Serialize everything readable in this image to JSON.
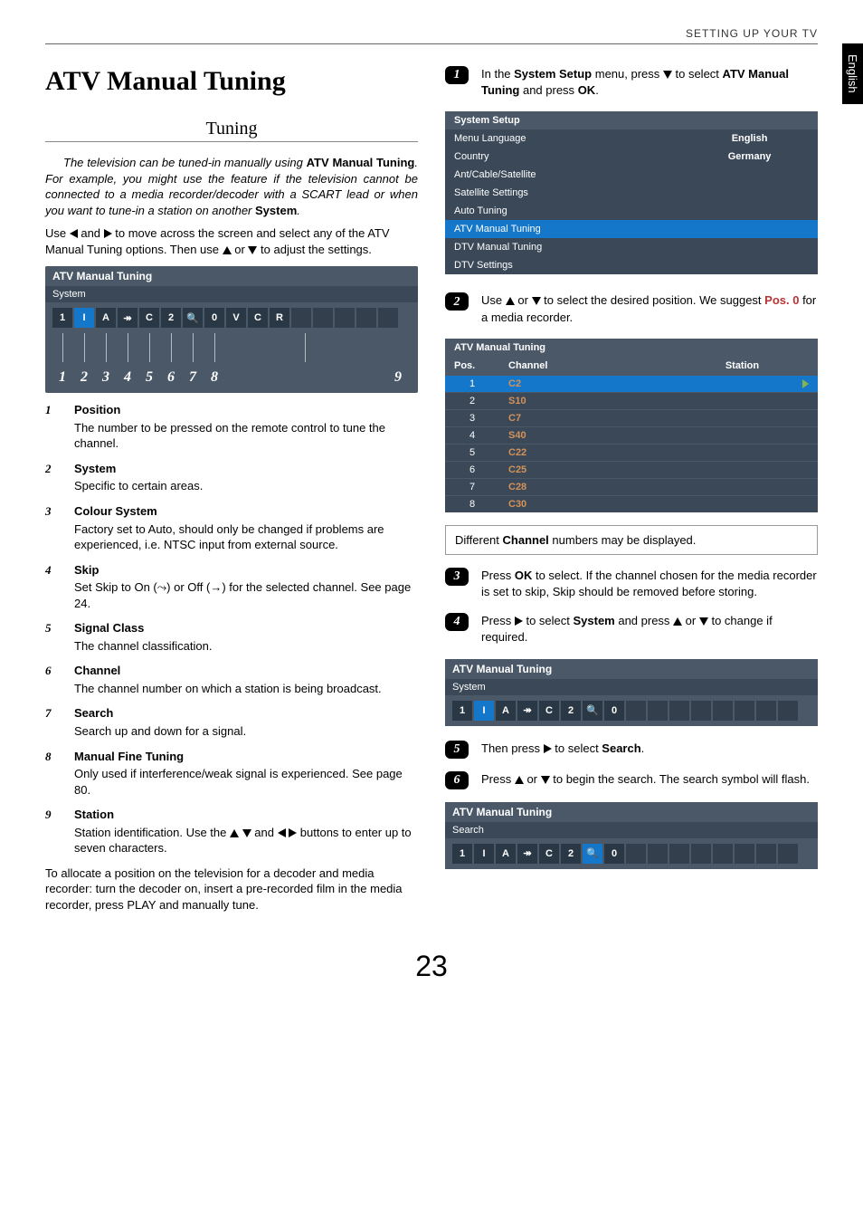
{
  "header": {
    "section": "SETTING UP YOUR TV",
    "lang_tab": "English"
  },
  "title": "ATV Manual Tuning",
  "subheading": "Tuning",
  "intro": {
    "pre": "The television can be tuned-in manually using ",
    "bold1": "ATV Manual Tuning",
    "mid": ". For example, you might use the feature if the television cannot be connected to a media recorder/decoder with a SCART lead or when you want to tune-in a station on another ",
    "bold2": "System",
    "post": "."
  },
  "use_arrows": {
    "p1a": "Use ",
    "p1b": " and ",
    "p1c": " to move across the screen and select any of the ATV Manual Tuning options. Then use ",
    "p1d": " or ",
    "p1e": " to adjust the settings."
  },
  "diagram": {
    "title": "ATV Manual Tuning",
    "sub": "System",
    "cells": [
      "1",
      "I",
      "A",
      "↠",
      "C",
      "2",
      "🔍",
      "0",
      "V",
      "C",
      "R",
      "",
      "",
      "",
      "",
      ""
    ],
    "numbers": [
      "1",
      "2",
      "3",
      "4",
      "5",
      "6",
      "7",
      "8"
    ],
    "last_number": "9"
  },
  "defs": [
    {
      "n": "1",
      "title": "Position",
      "body": "The number to be pressed on the remote control to tune the channel."
    },
    {
      "n": "2",
      "title": "System",
      "body": "Specific to certain areas."
    },
    {
      "n": "3",
      "title": "Colour System",
      "body": "Factory set to Auto, should only be changed if problems are experienced, i.e. NTSC input from external source."
    },
    {
      "n": "4",
      "title": "Skip",
      "body_pre": "Set Skip to On (",
      "icon_on": "⤳",
      "body_mid": ") or Off (",
      "icon_off": "→",
      "body_post": ") for the selected channel. See page 24."
    },
    {
      "n": "5",
      "title": "Signal Class",
      "body": "The channel classification."
    },
    {
      "n": "6",
      "title": "Channel",
      "body": "The channel number on which a station is being broadcast."
    },
    {
      "n": "7",
      "title": "Search",
      "body": "Search up and down for a signal."
    },
    {
      "n": "8",
      "title": "Manual Fine Tuning",
      "body": "Only used if interference/weak signal is experienced. See page 80."
    },
    {
      "n": "9",
      "title": "Station",
      "body_pre": "Station identification. Use the ",
      "body_post": " buttons to enter up to seven characters."
    }
  ],
  "allocate": "To allocate a position on the television for a decoder and media recorder: turn the decoder on, insert a pre-recorded film in the media recorder, press PLAY and manually tune.",
  "steps": {
    "s1": {
      "pre": "In the ",
      "b1": "System Setup",
      "mid": " menu, press ",
      "mid2": " to select ",
      "b2": "ATV Manual Tuning",
      "mid3": " and press ",
      "b3": "OK",
      "post": "."
    },
    "s2": {
      "pre": "Use ",
      "mid": " or ",
      "mid2": " to select the desired position. We suggest ",
      "pos": "Pos. 0",
      "post": " for a media recorder."
    },
    "s3": {
      "pre": "Press ",
      "b1": "OK",
      "post": " to select. If the channel chosen for the media recorder is set to skip, Skip should be removed before storing."
    },
    "s4": {
      "pre": "Press ",
      "mid": " to select ",
      "b1": "System",
      "mid2": " and press ",
      "mid3": " or ",
      "post": " to change if required."
    },
    "s5": {
      "pre": "Then press ",
      "mid": " to select ",
      "b1": "Search",
      "post": "."
    },
    "s6": {
      "pre": "Press ",
      "mid": " or ",
      "post": " to begin the search. The search symbol will flash."
    }
  },
  "menu_table": {
    "title": "System Setup",
    "rows": [
      {
        "label": "Menu Language",
        "value": "English"
      },
      {
        "label": "Country",
        "value": "Germany"
      },
      {
        "label": "Ant/Cable/Satellite",
        "value": ""
      },
      {
        "label": "Satellite Settings",
        "value": ""
      },
      {
        "label": "Auto Tuning",
        "value": ""
      },
      {
        "label": "ATV Manual Tuning",
        "value": "",
        "selected": true
      },
      {
        "label": "DTV Manual Tuning",
        "value": ""
      },
      {
        "label": "DTV Settings",
        "value": ""
      }
    ]
  },
  "channel_table": {
    "title": "ATV Manual Tuning",
    "headers": [
      "Pos.",
      "Channel",
      "Station"
    ],
    "rows": [
      {
        "pos": "1",
        "ch": "C2",
        "selected": true
      },
      {
        "pos": "2",
        "ch": "S10"
      },
      {
        "pos": "3",
        "ch": "C7"
      },
      {
        "pos": "4",
        "ch": "S40"
      },
      {
        "pos": "5",
        "ch": "C22"
      },
      {
        "pos": "6",
        "ch": "C25"
      },
      {
        "pos": "7",
        "ch": "C28"
      },
      {
        "pos": "8",
        "ch": "C30"
      }
    ]
  },
  "note": {
    "pre": "Different ",
    "b": "Channel",
    "post": " numbers may be displayed."
  },
  "screen_system": {
    "title": "ATV Manual Tuning",
    "sub": "System",
    "cells": [
      "1",
      "I",
      "A",
      "↠",
      "C",
      "2",
      "🔍",
      "0",
      "",
      "",
      "",
      "",
      "",
      "",
      "",
      ""
    ]
  },
  "screen_search": {
    "title": "ATV Manual Tuning",
    "sub": "Search",
    "cells": [
      "1",
      "I",
      "A",
      "↠",
      "C",
      "2",
      "🔍",
      "0",
      "",
      "",
      "",
      "",
      "",
      "",
      "",
      ""
    ]
  },
  "page_number": "23"
}
